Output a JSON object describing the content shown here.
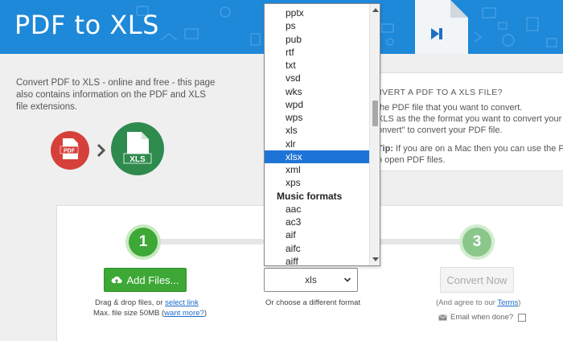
{
  "brand": {
    "title": "PDF to XLS"
  },
  "intro": {
    "text": "Convert PDF to XLS - online and free - this page also contains information on the PDF and XLS file extensions."
  },
  "icons": {
    "source_label": "PDF",
    "target_label": "XLS"
  },
  "info": {
    "heading": "NVERT A PDF TO A XLS FILE?",
    "line1": "the PDF file that you want to convert.",
    "line2": "XLS as the the format you want to convert your PDF",
    "line3": "onvert\" to convert your PDF file.",
    "tip_label": "Tip:",
    "line4": " If you are on a Mac then you can use the Prev",
    "line5": "o open PDF files."
  },
  "steps": {
    "step1": "1",
    "step3": "3"
  },
  "upload": {
    "button": "Add Files...",
    "drag_text": "Drag & drop files, or ",
    "select_link": "select link",
    "max_text": "Max. file size 50MB (",
    "more_link": "want more?",
    "max_close": ")"
  },
  "format": {
    "selected": "xls",
    "hint": "Or choose a different format",
    "options": [
      {
        "label": "pptx",
        "type": "option"
      },
      {
        "label": "ps",
        "type": "option"
      },
      {
        "label": "pub",
        "type": "option"
      },
      {
        "label": "rtf",
        "type": "option"
      },
      {
        "label": "txt",
        "type": "option"
      },
      {
        "label": "vsd",
        "type": "option"
      },
      {
        "label": "wks",
        "type": "option"
      },
      {
        "label": "wpd",
        "type": "option"
      },
      {
        "label": "wps",
        "type": "option"
      },
      {
        "label": "xls",
        "type": "option"
      },
      {
        "label": "xlr",
        "type": "option"
      },
      {
        "label": "xlsx",
        "type": "option",
        "highlighted": true
      },
      {
        "label": "xml",
        "type": "option"
      },
      {
        "label": "xps",
        "type": "option"
      },
      {
        "label": "Music formats",
        "type": "group"
      },
      {
        "label": "aac",
        "type": "option"
      },
      {
        "label": "ac3",
        "type": "option"
      },
      {
        "label": "aif",
        "type": "option"
      },
      {
        "label": "aifc",
        "type": "option"
      },
      {
        "label": "aiff",
        "type": "option"
      }
    ]
  },
  "convert": {
    "button": "Convert Now",
    "agree_text": "(And agree to our ",
    "terms_link": "Terms",
    "agree_close": ")",
    "email_label": "Email when done?"
  },
  "colors": {
    "header_blue": "#1e88d9",
    "green": "#3da835",
    "pdf_red": "#d5413a",
    "xls_green": "#2f8a4e",
    "highlight": "#1e74d6"
  }
}
